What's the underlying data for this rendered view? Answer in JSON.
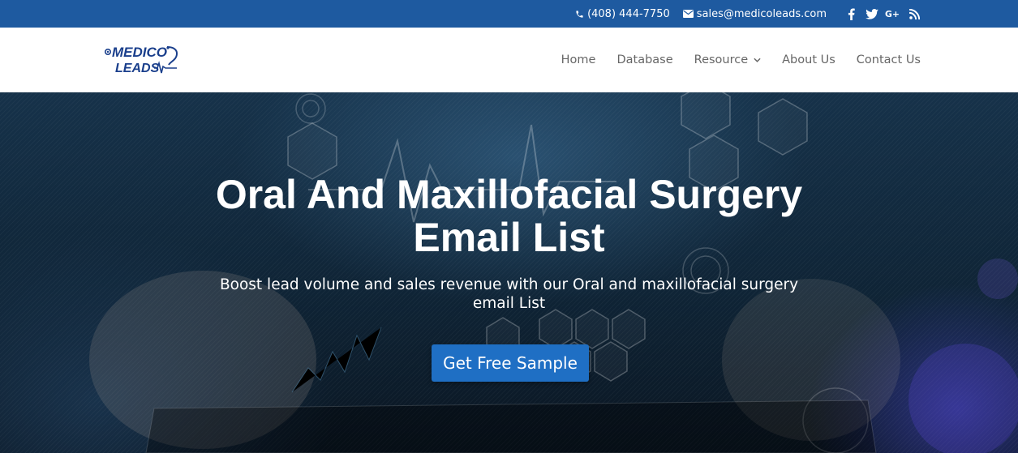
{
  "topbar": {
    "phone": "(408) 444-7750",
    "email": "sales@medicoleads.com",
    "social_icons": [
      "facebook-icon",
      "twitter-icon",
      "google-plus-icon",
      "rss-icon"
    ]
  },
  "logo": {
    "line1": "MEDICO",
    "line2": "LEADS"
  },
  "nav": {
    "items": [
      "Home",
      "Database",
      "Resource",
      "About Us",
      "Contact Us"
    ]
  },
  "hero": {
    "title": "Oral And Maxillofacial Surgery Email List",
    "subtitle": "Boost lead volume and  sales revenue with our Oral and maxillofacial surgery email List",
    "cta_label": "Get Free Sample"
  },
  "colors": {
    "topbar": "#1e5aa0",
    "cta": "#1f6fc4",
    "nav_text": "#666666",
    "logo_blue": "#1a3f8c"
  }
}
